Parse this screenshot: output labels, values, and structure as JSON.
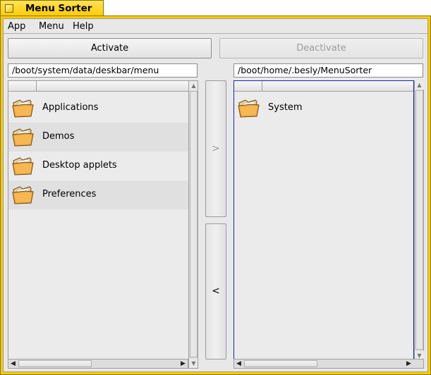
{
  "window": {
    "title": "Menu Sorter"
  },
  "menubar": {
    "items": [
      "App",
      "Menu",
      "Help"
    ]
  },
  "buttons": {
    "activate": "Activate",
    "deactivate": "Deactivate",
    "move_right": ">",
    "move_left": "<"
  },
  "left_panel": {
    "path": "/boot/system/data/deskbar/menu",
    "items": [
      {
        "label": "Applications",
        "icon": "folder-icon"
      },
      {
        "label": "Demos",
        "icon": "folder-icon"
      },
      {
        "label": "Desktop applets",
        "icon": "folder-icon"
      },
      {
        "label": "Preferences",
        "icon": "folder-icon"
      }
    ]
  },
  "right_panel": {
    "path": "/boot/home/.besly/MenuSorter",
    "items": [
      {
        "label": "System",
        "icon": "folder-icon"
      }
    ]
  },
  "colors": {
    "title_tab": "#ffcb00",
    "focus_border": "#1a22b0",
    "disabled_text": "#9c9c9c"
  }
}
